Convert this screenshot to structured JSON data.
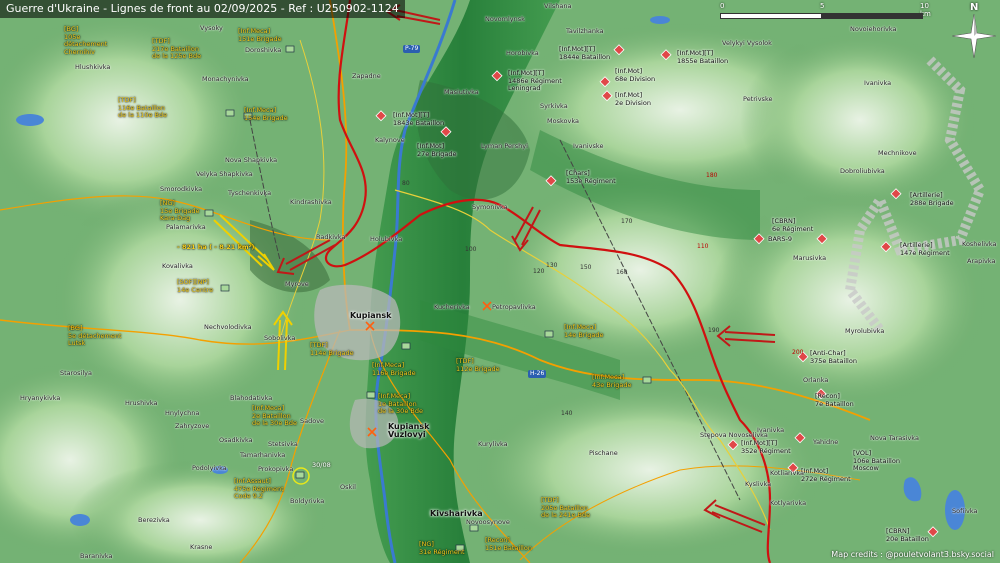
{
  "title": "Guerre d'Ukraine - Lignes de front au 02/09/2025 - Ref : U250902-1124",
  "credits": "Map credits : @pouletvolant3.bsky.social",
  "scale": {
    "labels": [
      "0",
      "5",
      "10 km"
    ]
  },
  "compass": {
    "label": "N"
  },
  "roads": {
    "p79": "P-79",
    "h26": "H-26"
  },
  "area_note": "- 821 ha ( - 8.21 km²)",
  "date_marker": "30/08",
  "colors": {
    "ukraine_units": "#f5d020",
    "russia_units": "#111111",
    "front_line": "#d01010",
    "russian_arrows": "#c01818",
    "ukraine_arrows": "#f0d000",
    "ru_unit_marker": "#e04848",
    "ua_unit_marker": "#a8d89a"
  },
  "ukraine_units": [
    {
      "text": "[BG]\n105e\ndétachement\nChernihiv"
    },
    {
      "text": "[TDF]\n217e Bataillon\nde la 125e Bde"
    },
    {
      "text": "[Inf.Meca]\n151e Brigade"
    },
    {
      "text": "[TDF]\n116e Bataillon\nde la 110e Bde"
    },
    {
      "text": "[Inf.Meca]\n154e Brigade"
    },
    {
      "text": "[NG]\n15e Brigade\nKara-Dag"
    },
    {
      "text": "[SOF][NP]\n14e Centre"
    },
    {
      "text": "[BG]\n5e détachement\nLutsk"
    },
    {
      "text": "[TDF]\n114e Brigade"
    },
    {
      "text": "[Inf.Meca]\n116e Brigade"
    },
    {
      "text": "[TDF]\n112e Brigade"
    },
    {
      "text": "[Inf.Meca]\n14e Brigade"
    },
    {
      "text": "[Inf.Meca]\n43e Brigade"
    },
    {
      "text": "[Inf.Meca]\n1e Bataillon\nde la 30e Bde"
    },
    {
      "text": "[Inf.Meca]\n2e Bataillon\nde la 30e Bde"
    },
    {
      "text": "[Inf.Assaut]\n475e Régiment\nCode 9.2"
    },
    {
      "text": "[TDF]\n205e Bataillon\nde la 241e Bde"
    },
    {
      "text": "[NG]\n31e Régiment"
    },
    {
      "text": "[Recon]\n151e Bataillon"
    }
  ],
  "russian_units": [
    {
      "text": "[Inf.Mot][T]\n1844e Bataillon"
    },
    {
      "text": "[Inf.Mot][T]\n1855e Bataillon"
    },
    {
      "text": "[Inf.Mot][T]\n1486e Régiment\nLeningrad"
    },
    {
      "text": "[Inf.Mot]\n68e Division"
    },
    {
      "text": "[Inf.Mot]\n2e Division"
    },
    {
      "text": "[Inf.Mot][T]\n1843e Bataillon"
    },
    {
      "text": "[Inf.Mot]\n27e Brigade"
    },
    {
      "text": "[Chars]\n153e Régiment"
    },
    {
      "text": "[CBRN]\n6e Régiment"
    },
    {
      "text": "BARS-9"
    },
    {
      "text": "[Artillerie]\n288e Brigade"
    },
    {
      "text": "[Artillerie]\n147e Régiment"
    },
    {
      "text": "[Anti-Char]\n375e Bataillon"
    },
    {
      "text": "[Recon]\n7e Bataillon"
    },
    {
      "text": "[Inf.Mot][T]\n352e Régiment"
    },
    {
      "text": "[VOL]\n106e Bataillon\nMoscow"
    },
    {
      "text": "[Inf.Mot]\n272e Régiment"
    },
    {
      "text": "[CBRN]\n20e Bataillon"
    }
  ],
  "major_towns": [
    "Kupiansk",
    "Kupiansk\nVuzlovyi",
    "Kivsharivka"
  ],
  "towns": [
    "Vilshana",
    "Novomlynsk",
    "Vysoky",
    "Doroshivka",
    "Zapadne",
    "Horobivka",
    "Tavilzhanka",
    "Velykyi Vysolok",
    "Novoiehorivka",
    "Hlushkivka",
    "Monachynivka",
    "Petrivske",
    "Ivanivka",
    "Masiutivka",
    "Kalynove",
    "Symonivka",
    "Lyman Pershyi",
    "Ivanivske",
    "Moskovka",
    "Nova Shapkivka",
    "Velyka Shapkivka",
    "Tyschenkivka",
    "Kindrashivka",
    "Smorodkivka",
    "Palamarivka",
    "Syrkivka",
    "Dobroliubivka",
    "Mechnikove",
    "Radkivka",
    "Holubivka",
    "Kovalivka",
    "Myrove",
    "Marusivka",
    "Kotliarivka",
    "Koshelivka",
    "Arapivka",
    "Nechvolodivka",
    "Sobolivka",
    "Kucherivka",
    "Petropavlivka",
    "Myrolubivka",
    "Starosilya",
    "Hrushivka",
    "Orlanka",
    "Blahodativka",
    "Sadove",
    "Hnylychna",
    "Zahryzove",
    "Ivanivka",
    "Yahidne",
    "Nova Tarasivka",
    "Kurylivka",
    "Stepova Novoselivka",
    "Pischane",
    "Osadkivka",
    "Stetsivka",
    "Tamarhanivka",
    "Prokopivka",
    "Podolyivka",
    "Kyslivka",
    "Kotlyarivka",
    "Berezivka",
    "Boldyrivka",
    "Oskil",
    "Novoosynove",
    "Baranivka",
    "Sofiivka",
    "Krasne",
    "Hryanykivka"
  ],
  "elevations": [
    "80",
    "100",
    "110",
    "120",
    "130",
    "140",
    "150",
    "160",
    "170",
    "180",
    "190",
    "200"
  ]
}
